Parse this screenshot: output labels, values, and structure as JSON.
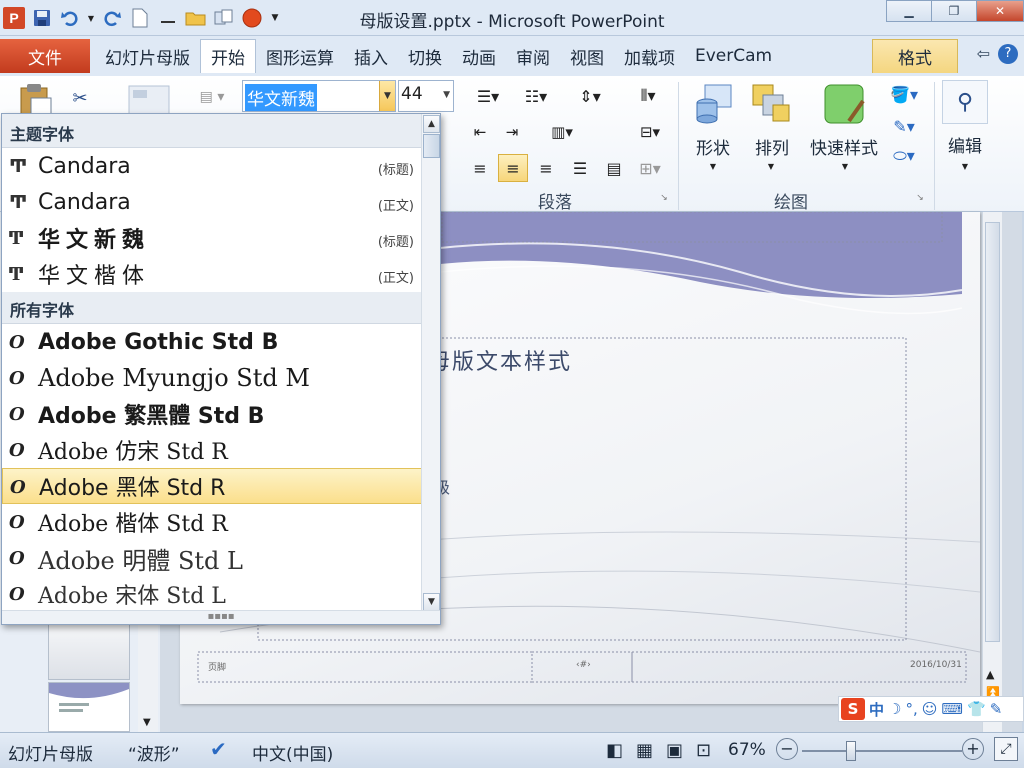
{
  "window": {
    "title": "母版设置.pptx - Microsoft PowerPoint",
    "app_logo_letter": "P"
  },
  "tabs": {
    "file": "文件",
    "items": [
      "幻灯片母版",
      "开始",
      "图形运算",
      "插入",
      "切换",
      "动画",
      "审阅",
      "视图",
      "加载项",
      "EverCam"
    ],
    "active": "开始",
    "contextual": "格式"
  },
  "ribbon": {
    "font_name": "华文新魏",
    "font_size": "44",
    "groups": {
      "paragraph": "段落",
      "drawing": "绘图"
    },
    "buttons": {
      "shape": "形状",
      "arrange": "排列",
      "quick_styles": "快速样式",
      "edit": "编辑"
    }
  },
  "font_dropdown": {
    "theme_header": "主题字体",
    "theme_fonts": [
      {
        "name": "Candara",
        "tag": "(标题)"
      },
      {
        "name": "Candara",
        "tag": "(正文)"
      },
      {
        "name": "华文新魏",
        "tag": "(标题)"
      },
      {
        "name": "华文楷体",
        "tag": "(正文)"
      }
    ],
    "all_header": "所有字体",
    "all_fonts": [
      "Adobe Gothic Std B",
      "Adobe Myungjo Std M",
      "Adobe 繁黑體 Std B",
      "Adobe 仿宋 Std R",
      "Adobe 黑体 Std R",
      "Adobe 楷体 Std R",
      "Adobe 明體 Std L",
      "Adobe 宋体 Std L"
    ],
    "selected": "Adobe 黑体 Std R"
  },
  "slide": {
    "body_text": "母版文本样式",
    "second_level_char": "级",
    "footer_text": "页脚",
    "number_placeholder": "‹#›",
    "date_text": "2016/10/31"
  },
  "ime": {
    "label": "中"
  },
  "statusbar": {
    "view": "幻灯片母版",
    "theme": "“波形”",
    "language": "中文(中国)",
    "zoom": "67%"
  },
  "colors": {
    "file_tab": "#d24726",
    "highlight": "#fbdf8c",
    "selection": "#3399ff"
  }
}
